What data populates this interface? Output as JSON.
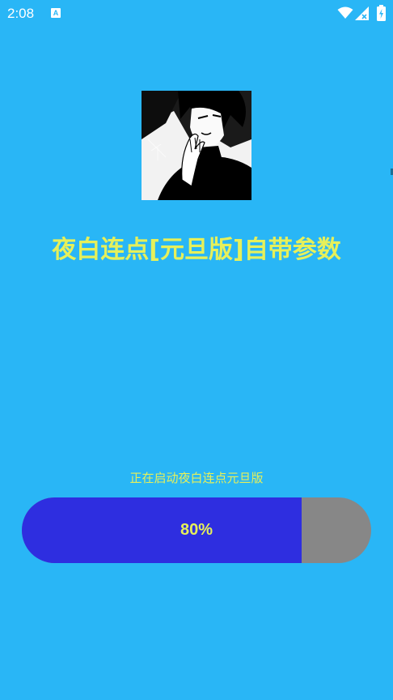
{
  "status_bar": {
    "time": "2:08",
    "notification_icon": "app-notification-icon",
    "notification_glyph": "A",
    "icons": [
      "wifi-icon",
      "signal-no-sim-icon",
      "battery-charging-icon"
    ]
  },
  "splash": {
    "logo_icon": "anime-character-logo",
    "title": "夜白连点[元旦版]自带参数",
    "loading_message": "正在启动夜白连点元旦版",
    "progress": {
      "percent": 80,
      "label": "80%"
    }
  },
  "colors": {
    "background": "#29b6f6",
    "title_text": "#e6f05a",
    "progress_fill": "#2e2ee0",
    "progress_track": "#878787"
  }
}
